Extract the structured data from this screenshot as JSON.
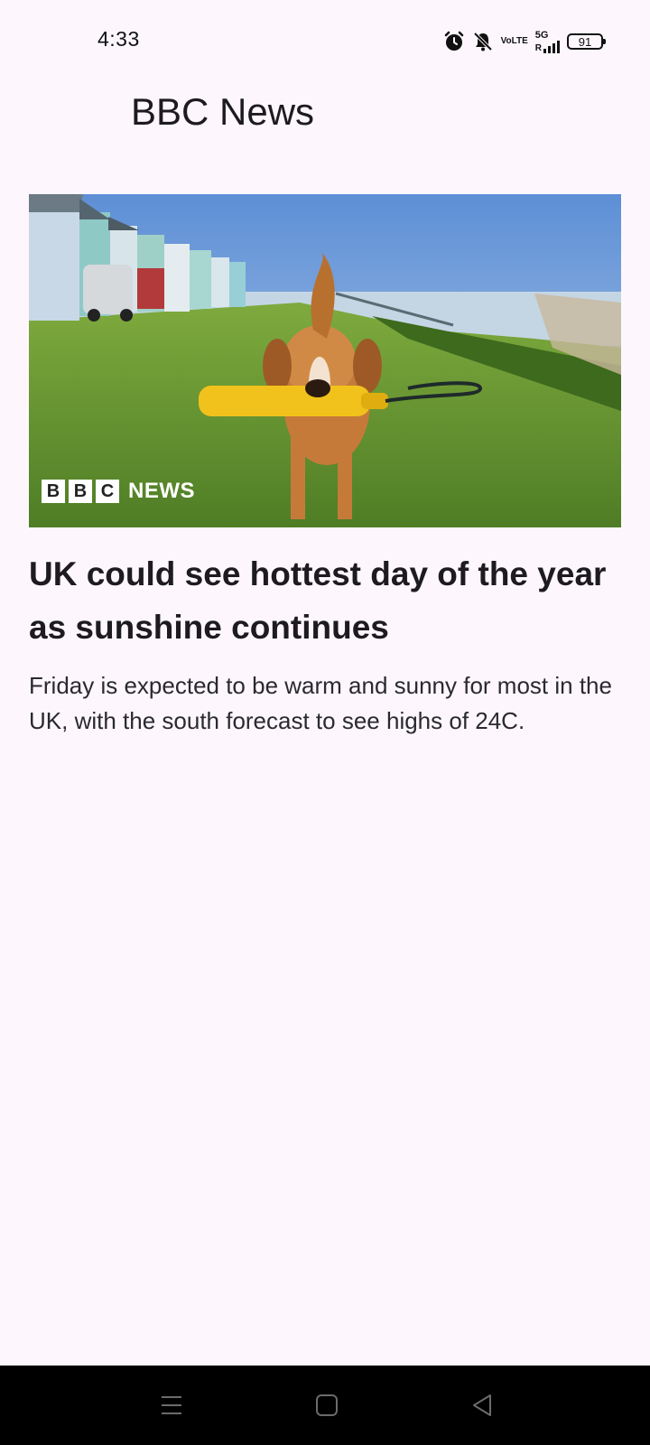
{
  "status_bar": {
    "time": "4:33",
    "icons": [
      "alarm-icon",
      "mute-icon",
      "volte-icon",
      "5g-signal-icon",
      "battery-icon"
    ],
    "volte_top": "Vo",
    "volte_bottom": "LTE",
    "network": "5G",
    "network_sub": "R",
    "battery_level": "91"
  },
  "app": {
    "title": "BBC News"
  },
  "article": {
    "image_alt": "Spaniel dog carrying a yellow toy on grass by beach huts",
    "logo_letters": [
      "B",
      "B",
      "C"
    ],
    "logo_word": "NEWS",
    "headline": "UK could see hottest day of the year as sunshine continues",
    "summary": "Friday is expected to be warm and sunny for most in the UK, with the south forecast to see highs of 24C."
  },
  "nav_bar": {
    "buttons": [
      "menu-icon",
      "home-icon",
      "back-icon"
    ]
  },
  "colors": {
    "background": "#fdf7fd",
    "text": "#1d1b20",
    "nav_bar": "#000000"
  }
}
